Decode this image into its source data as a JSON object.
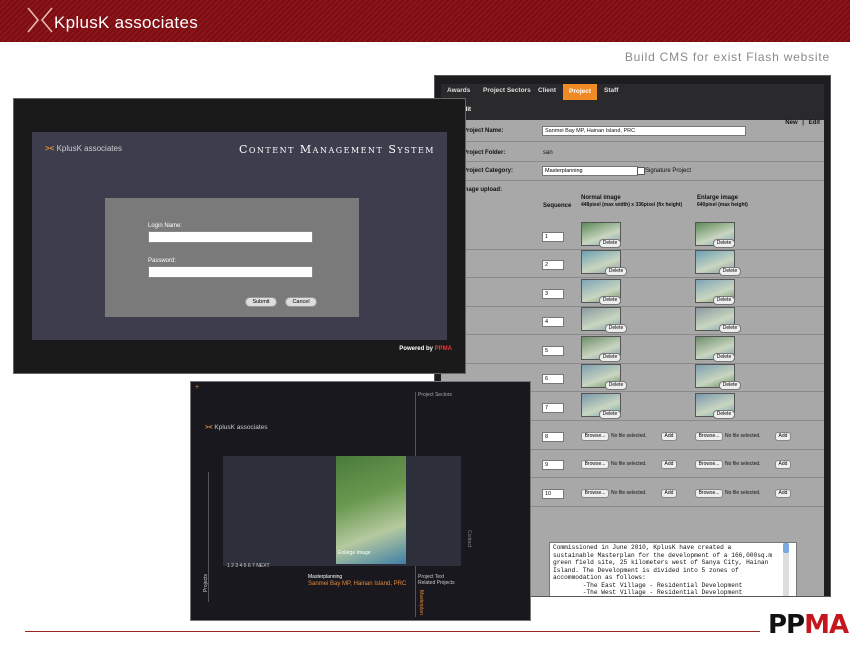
{
  "header": {
    "title": "KplusK associates",
    "tagline": "Build CMS for exist Flash website"
  },
  "brand": {
    "pp": "PP",
    "ma": "MA"
  },
  "colors": {
    "header": "#7a0d12",
    "accent": "#f08a24",
    "brand_red": "#c4161c"
  },
  "edit_screen": {
    "tabs": [
      "Awards",
      "Project Sectors",
      "Client",
      "Project",
      "Staff"
    ],
    "active_tab": "Project",
    "section_title": "ts - Edit",
    "new_label": "New",
    "separator": "|",
    "edit_label": "Edit",
    "project_name_label": "Project Name:",
    "project_name_value": "Sanmei Bay MP, Hainan Island, PRC",
    "project_folder_label": "Project Folder:",
    "project_folder_value": "san",
    "project_category_label": "Project Category:",
    "project_category_value": "Masterplanning",
    "signature_label": "Signature Project",
    "image_upload_label": "mage upload:",
    "sequence_label": "Sequence",
    "normal_image_label": "Normal image",
    "normal_image_size": "448pixel (max width) x 336pixel (fix height)",
    "enlarge_image_label": "Enlarge image",
    "enlarge_image_size": "640pixel (max height)",
    "delete_label": "Delete",
    "browse_label": "Browse...",
    "no_file_label": "No file selected.",
    "add_label": "Add",
    "sequences": [
      "1",
      "2",
      "3",
      "4",
      "5",
      "6",
      "7",
      "8",
      "9",
      "10"
    ],
    "description": "Commissioned in June 2010, KplusK have created a\nsustainable Masterplan for the development of a 166,000sq.m\ngreen field site, 25 kilometers west of Sanya City, Hainan\nIsland. The Development is divided into 5 zones of\naccommodation as follows:\n        -The East Village - Residential Development\n        -The West Village - Residential Development\n        -The Central Park\n        -The Hotel"
  },
  "login_screen": {
    "logo": "KplusK associates",
    "title": "Content Management System",
    "login_name_label": "Login Name:",
    "password_label": "Password:",
    "submit_label": "Submit",
    "cancel_label": "Cancel",
    "powered_by": "Powered by",
    "powered_brand": "PPMA"
  },
  "site_screen": {
    "logo": "KplusK associates",
    "project_sectors": "Project Sectors",
    "enlarge_image": "Enlarge Image",
    "pager": "1  2  3  4  5  6  7    NEXT",
    "category": "Masterplanning",
    "project_name": "Sanmei Bay MP, Hainan Island, PRC",
    "project_text": "Project Text",
    "related_projects": "Related Projects",
    "side_left": "Projects",
    "side_right": "Contact",
    "side_bottom": "Masterplan"
  }
}
